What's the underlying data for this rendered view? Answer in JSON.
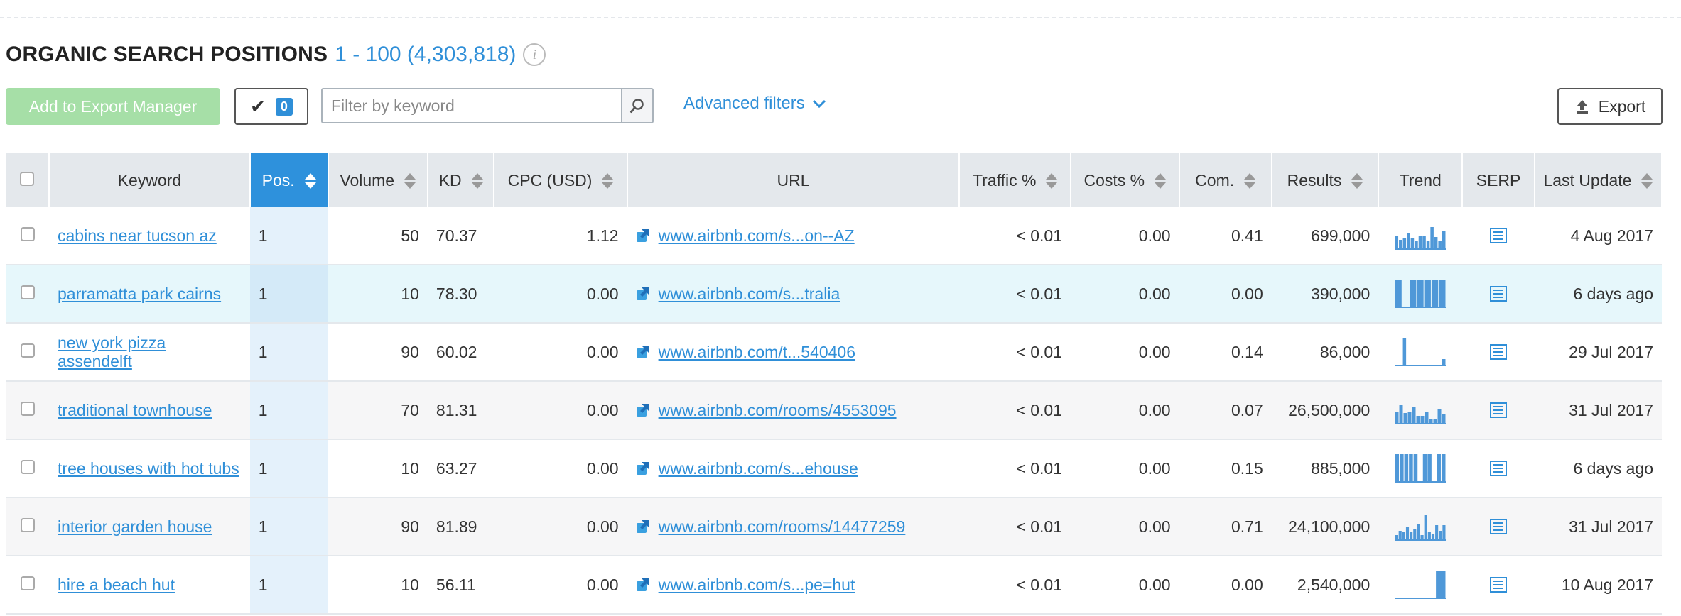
{
  "header": {
    "title": "ORGANIC SEARCH POSITIONS",
    "range": "1 - 100 (4,303,818)",
    "info_symbol": "i"
  },
  "toolbar": {
    "add_export_label": "Add to Export Manager",
    "selected_count": "0",
    "filter_placeholder": "Filter by keyword",
    "advanced_filters_label": "Advanced filters",
    "export_label": "Export"
  },
  "columns": {
    "keyword": "Keyword",
    "pos": "Pos.",
    "volume": "Volume",
    "kd": "KD",
    "cpc": "CPC (USD)",
    "url": "URL",
    "traffic": "Traffic %",
    "costs": "Costs %",
    "com": "Com.",
    "results": "Results",
    "trend": "Trend",
    "serp": "SERP",
    "last_update": "Last Update"
  },
  "rows": [
    {
      "keyword": "cabins near tucson az",
      "pos": "1",
      "volume": "50",
      "kd": "70.37",
      "cpc": "1.12",
      "url": "www.airbnb.com/s...on--AZ",
      "traffic": "< 0.01",
      "costs": "0.00",
      "com": "0.41",
      "results": "699,000",
      "trend": [
        0.5,
        0.35,
        0.4,
        0.6,
        0.4,
        0.3,
        0.5,
        0.5,
        0.3,
        0.8,
        0.45,
        0.3,
        0.65
      ],
      "last_update": "4 Aug 2017"
    },
    {
      "keyword": "parramatta park cairns",
      "pos": "1",
      "volume": "10",
      "kd": "78.30",
      "cpc": "0.00",
      "url": "www.airbnb.com/s...tralia",
      "traffic": "< 0.01",
      "costs": "0.00",
      "com": "0.00",
      "results": "390,000",
      "trend": [
        1,
        0,
        1,
        1,
        1,
        1,
        1
      ],
      "last_update": "6 days ago"
    },
    {
      "keyword": "new york pizza assendelft",
      "pos": "1",
      "volume": "90",
      "kd": "60.02",
      "cpc": "0.00",
      "url": "www.airbnb.com/t...540406",
      "traffic": "< 0.01",
      "costs": "0.00",
      "com": "0.14",
      "results": "86,000",
      "trend": [
        0.05,
        0.05,
        1,
        0.05,
        0.05,
        0.05,
        0.05,
        0.05,
        0.05,
        0.05,
        0.05,
        0.05,
        0.25
      ],
      "last_update": "29 Jul 2017"
    },
    {
      "keyword": "traditional townhouse",
      "pos": "1",
      "volume": "70",
      "kd": "81.31",
      "cpc": "0.00",
      "url": "www.airbnb.com/rooms/4553095",
      "traffic": "< 0.01",
      "costs": "0.00",
      "com": "0.07",
      "results": "26,500,000",
      "trend": [
        0.45,
        0.7,
        0.4,
        0.45,
        0.6,
        0.3,
        0.3,
        0.45,
        0.2,
        0.2,
        0.55,
        0.35
      ],
      "last_update": "31 Jul 2017"
    },
    {
      "keyword": "tree houses with hot tubs",
      "pos": "1",
      "volume": "10",
      "kd": "63.27",
      "cpc": "0.00",
      "url": "www.airbnb.com/s...ehouse",
      "traffic": "< 0.01",
      "costs": "0.00",
      "com": "0.15",
      "results": "885,000",
      "trend": [
        1,
        1,
        1,
        1,
        1,
        0,
        1,
        1,
        0,
        1,
        1
      ],
      "last_update": "6 days ago"
    },
    {
      "keyword": "interior garden house",
      "pos": "1",
      "volume": "90",
      "kd": "81.89",
      "cpc": "0.00",
      "url": "www.airbnb.com/rooms/14477259",
      "traffic": "< 0.01",
      "costs": "0.00",
      "com": "0.71",
      "results": "24,100,000",
      "trend": [
        0.2,
        0.35,
        0.3,
        0.5,
        0.3,
        0.4,
        0.6,
        0.2,
        0.9,
        0.3,
        0.25,
        0.55,
        0.35,
        0.55
      ],
      "last_update": "31 Jul 2017"
    },
    {
      "keyword": "hire a beach hut",
      "pos": "1",
      "volume": "10",
      "kd": "56.11",
      "cpc": "0.00",
      "url": "www.airbnb.com/s...pe=hut",
      "traffic": "< 0.01",
      "costs": "0.00",
      "com": "0.00",
      "results": "2,540,000",
      "trend": [
        0,
        0,
        0,
        0,
        1
      ],
      "last_update": "10 Aug 2017"
    }
  ],
  "colors": {
    "accent": "#2f8fd8",
    "trend_bar": "#4f98d8",
    "export_manager_bg": "#a6dfa7",
    "header_bg": "#e4e8ec",
    "sorted_header_bg": "#2e91dc"
  },
  "icons": {
    "search": "search-icon",
    "chevron": "chevron-down-icon",
    "export": "upload-icon",
    "external_link": "external-link-icon",
    "serp": "serp-list-icon",
    "check": "checkmark-icon"
  }
}
